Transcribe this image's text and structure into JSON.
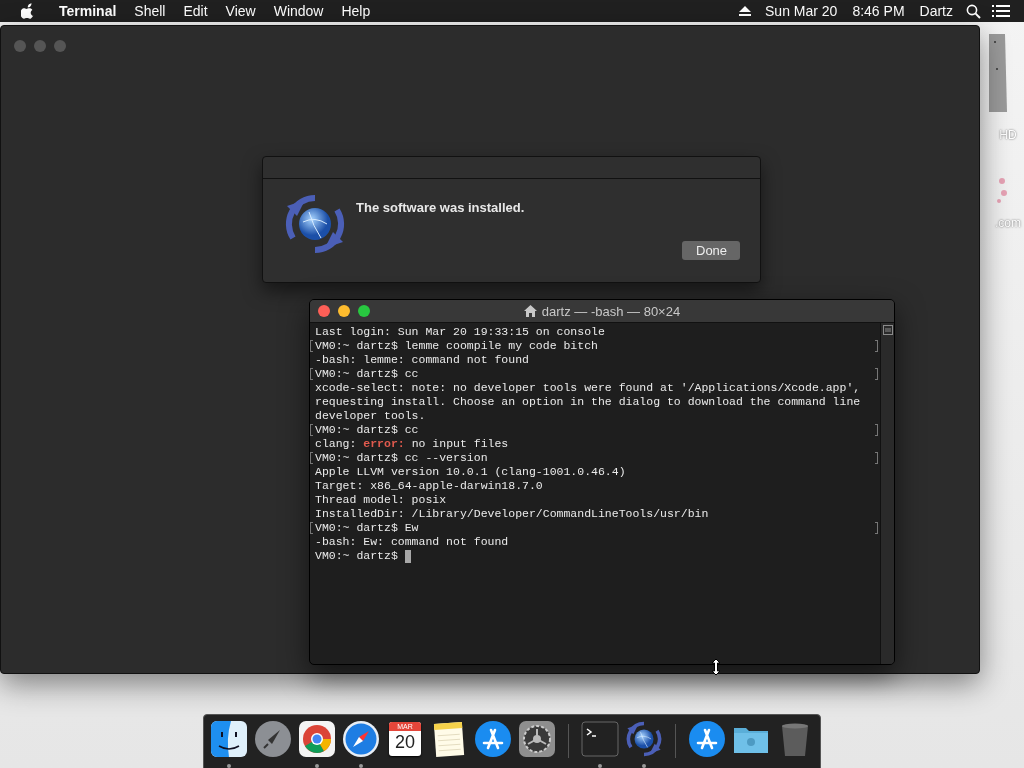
{
  "menu_bar": {
    "app": "Terminal",
    "items": [
      "Shell",
      "Edit",
      "View",
      "Window",
      "Help"
    ],
    "date": "Sun Mar 20",
    "time": "8:46 PM",
    "user": "Dartz"
  },
  "desktop_labels": [
    "HD",
    ".com"
  ],
  "dialog": {
    "message": "The software was installed.",
    "button": "Done"
  },
  "terminal": {
    "title": "dartz — -bash — 80×24",
    "lines": [
      {
        "marked": false,
        "parts": [
          {
            "kind": "plain",
            "text": "Last login: Sun Mar 20 19:33:15 on console"
          }
        ]
      },
      {
        "marked": true,
        "parts": [
          {
            "kind": "plain",
            "text": "VM0:~ dartz$ lemme coompile my code bitch"
          }
        ]
      },
      {
        "marked": false,
        "parts": [
          {
            "kind": "plain",
            "text": "-bash: lemme: command not found"
          }
        ]
      },
      {
        "marked": true,
        "parts": [
          {
            "kind": "plain",
            "text": "VM0:~ dartz$ cc"
          }
        ]
      },
      {
        "marked": false,
        "parts": [
          {
            "kind": "plain",
            "text": "xcode-select: note: no developer tools were found at '/Applications/Xcode.app',"
          }
        ]
      },
      {
        "marked": false,
        "parts": [
          {
            "kind": "plain",
            "text": "requesting install. Choose an option in the dialog to download the command line"
          }
        ]
      },
      {
        "marked": false,
        "parts": [
          {
            "kind": "plain",
            "text": "developer tools."
          }
        ]
      },
      {
        "marked": true,
        "parts": [
          {
            "kind": "plain",
            "text": "VM0:~ dartz$ cc"
          }
        ]
      },
      {
        "marked": false,
        "parts": [
          {
            "kind": "plain",
            "text": "clang: "
          },
          {
            "kind": "error",
            "text": "error:"
          },
          {
            "kind": "plain",
            "text": " no input files"
          }
        ]
      },
      {
        "marked": true,
        "parts": [
          {
            "kind": "plain",
            "text": "VM0:~ dartz$ cc --version"
          }
        ]
      },
      {
        "marked": false,
        "parts": [
          {
            "kind": "plain",
            "text": "Apple LLVM version 10.0.1 (clang-1001.0.46.4)"
          }
        ]
      },
      {
        "marked": false,
        "parts": [
          {
            "kind": "plain",
            "text": "Target: x86_64-apple-darwin18.7.0"
          }
        ]
      },
      {
        "marked": false,
        "parts": [
          {
            "kind": "plain",
            "text": "Thread model: posix"
          }
        ]
      },
      {
        "marked": false,
        "parts": [
          {
            "kind": "plain",
            "text": "InstalledDir: /Library/Developer/CommandLineTools/usr/bin"
          }
        ]
      },
      {
        "marked": true,
        "parts": [
          {
            "kind": "plain",
            "text": "VM0:~ dartz$ Ew"
          }
        ]
      },
      {
        "marked": false,
        "parts": [
          {
            "kind": "plain",
            "text": "-bash: Ew: command not found"
          }
        ]
      },
      {
        "marked": false,
        "parts": [
          {
            "kind": "plain",
            "text": "VM0:~ dartz$ "
          },
          {
            "kind": "cursor"
          }
        ]
      }
    ]
  },
  "dock": {
    "items": [
      {
        "kind": "finder",
        "running": true
      },
      {
        "kind": "launchpad",
        "running": false
      },
      {
        "kind": "chrome",
        "running": true
      },
      {
        "kind": "safari",
        "running": true
      },
      {
        "kind": "calendar",
        "running": false,
        "month": "MAR",
        "day": "20"
      },
      {
        "kind": "notes",
        "running": false
      },
      {
        "kind": "appstore",
        "running": false
      },
      {
        "kind": "settings",
        "running": false
      },
      {
        "kind": "separator"
      },
      {
        "kind": "terminal",
        "running": true
      },
      {
        "kind": "update",
        "running": true
      },
      {
        "kind": "separator"
      },
      {
        "kind": "downloads",
        "running": false
      },
      {
        "kind": "folder",
        "running": false
      },
      {
        "kind": "trash",
        "running": false
      }
    ]
  }
}
